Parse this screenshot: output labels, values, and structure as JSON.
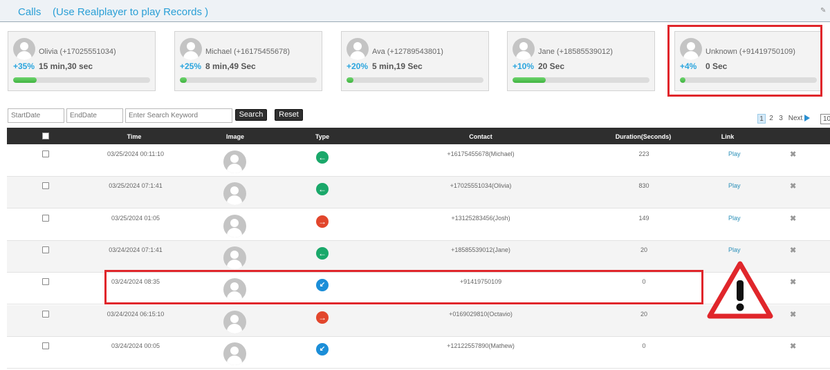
{
  "header": {
    "title": "Calls",
    "subtitle": "(Use Realplayer to play Records )"
  },
  "cards": [
    {
      "name": "Olivia (+17025551034)",
      "percent": "+35%",
      "duration": "15 min,30 sec",
      "progress": 0.17
    },
    {
      "name": "Michael (+16175455678)",
      "percent": "+25%",
      "duration": "8 min,49 Sec",
      "progress": 0.05
    },
    {
      "name": "Ava (+12789543801)",
      "percent": "+20%",
      "duration": "5 min,19 Sec",
      "progress": 0.05
    },
    {
      "name": "Jane (+18585539012)",
      "percent": "+10%",
      "duration": "20 Sec",
      "progress": 0.24
    },
    {
      "name": "Unknown (+91419750109)",
      "percent": "+4%",
      "duration": "0 Sec",
      "progress": 0.04
    }
  ],
  "toolbar": {
    "start_placeholder": "StartDate",
    "end_placeholder": "EndDate",
    "search_placeholder": "Enter Search Keyword",
    "search_label": "Search",
    "reset_label": "Reset"
  },
  "pagination": {
    "pages": [
      "1",
      "2",
      "3"
    ],
    "current": "1",
    "next_label": "Next",
    "per_page": "10"
  },
  "table": {
    "headers": {
      "time": "Time",
      "image": "Image",
      "type": "Type",
      "contact": "Contact",
      "duration": "Duration(Seconds)",
      "link": "Link"
    },
    "rows": [
      {
        "time": "03/25/2024 00:11:10",
        "type": "incoming",
        "contact": "+16175455678(Michael)",
        "duration": "223",
        "link": "Play"
      },
      {
        "time": "03/25/2024 07:1:41",
        "type": "incoming",
        "contact": "+17025551034(Olivia)",
        "duration": "830",
        "link": "Play"
      },
      {
        "time": "03/25/2024 01:05",
        "type": "outgoing",
        "contact": "+13125283456(Josh)",
        "duration": "149",
        "link": "Play"
      },
      {
        "time": "03/24/2024 07:1:41",
        "type": "incoming",
        "contact": "+18585539012(Jane)",
        "duration": "20",
        "link": "Play"
      },
      {
        "time": "03/24/2024 08:35",
        "type": "missed",
        "contact": "+91419750109",
        "duration": "0",
        "link": ""
      },
      {
        "time": "03/24/2024 06:15:10",
        "type": "outgoing",
        "contact": "+0169029810(Octavio)",
        "duration": "20",
        "link": ""
      },
      {
        "time": "03/24/2024 00:05",
        "type": "missed",
        "contact": "+12122557890(Mathew)",
        "duration": "0",
        "link": ""
      }
    ]
  },
  "icons": {
    "incoming": "arrow-left-icon",
    "outgoing": "arrow-right-icon",
    "missed": "missed-call-icon",
    "delete": "close-icon",
    "warning": "warning-icon"
  },
  "colors": {
    "accent": "#2aa5de",
    "highlight": "#e0262b",
    "incoming": "#1aa86a",
    "outgoing": "#e2462c",
    "missed": "#1b8ed8",
    "progress": "#4cbf4c"
  }
}
